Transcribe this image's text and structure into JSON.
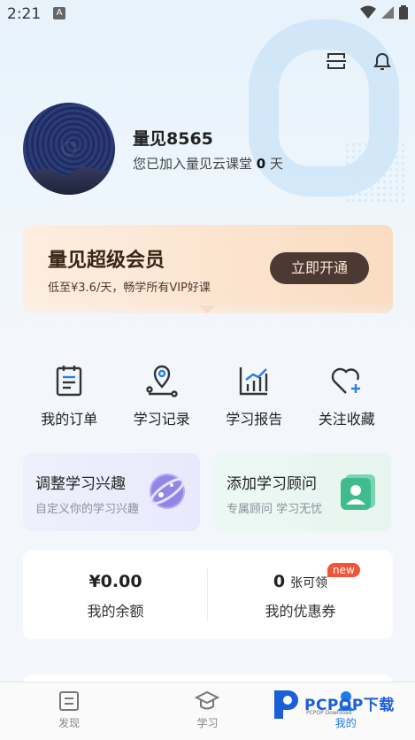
{
  "status_bar": {
    "time": "2:21",
    "notif_icon": "A"
  },
  "header": {
    "scan_icon": "scan-icon",
    "bell_icon": "bell-icon"
  },
  "profile": {
    "username": "量见8565",
    "joined_prefix": "您已加入量见云课堂 ",
    "joined_days": "0",
    "joined_suffix": " 天"
  },
  "vip": {
    "title": "量见超级会员",
    "subtitle": "低至¥3.6/天，畅学所有VIP好课",
    "button": "立即开通"
  },
  "quick_actions": [
    {
      "label": "我的订单",
      "icon": "order-icon"
    },
    {
      "label": "学习记录",
      "icon": "location-record-icon"
    },
    {
      "label": "学习报告",
      "icon": "report-chart-icon"
    },
    {
      "label": "关注收藏",
      "icon": "heart-plus-icon"
    }
  ],
  "cards": {
    "interest": {
      "title": "调整学习兴趣",
      "subtitle": "自定义你的学习兴趣"
    },
    "advisor": {
      "title": "添加学习顾问",
      "subtitle": "专属顾问 学习无忧"
    }
  },
  "balance": {
    "amount": "¥0.00",
    "amount_label": "我的余额",
    "coupon_count": "0",
    "coupon_unit": "张可领",
    "coupon_label": "我的优惠券",
    "badge": "new"
  },
  "bottom_nav": [
    {
      "label": "发现",
      "icon": "discover-icon"
    },
    {
      "label": "学习",
      "icon": "graduation-cap-icon"
    },
    {
      "label": "我的",
      "icon": "profile-icon"
    }
  ],
  "watermark": {
    "text": "PCPOP下载",
    "sub": "PCPOP Download"
  },
  "colors": {
    "accent": "#1e7be8",
    "vip_button": "#4a3a33",
    "badge": "#f0553a"
  }
}
